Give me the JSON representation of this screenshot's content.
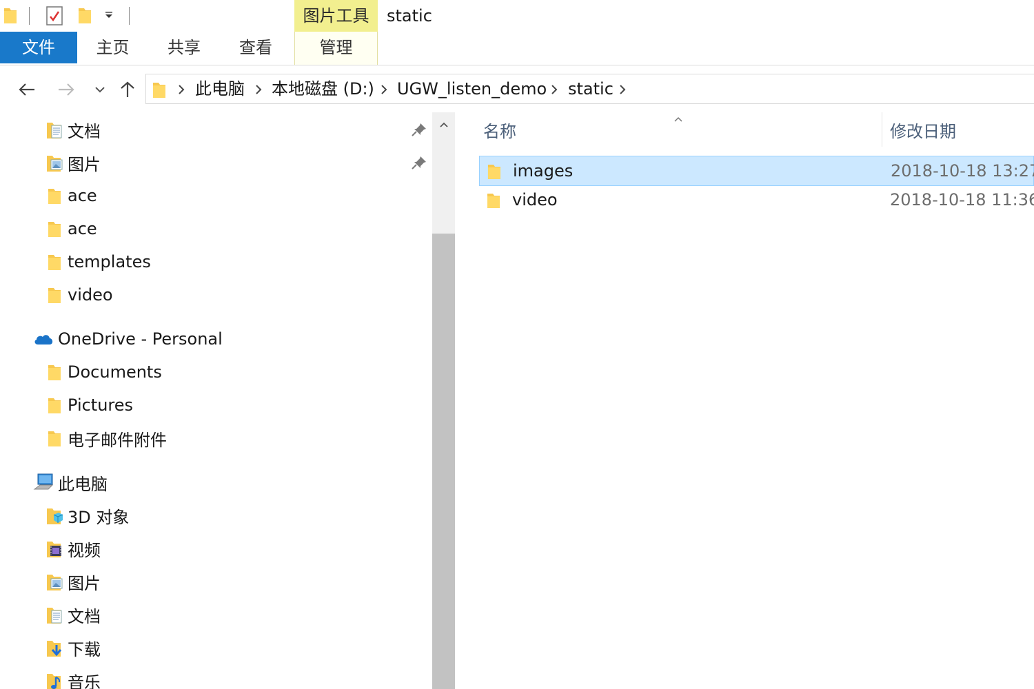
{
  "window": {
    "title": "static",
    "context_tab_label": "图片工具"
  },
  "quick_access_toolbar": {
    "items": [
      "folder-icon",
      "properties-icon",
      "new-folder-icon",
      "customize-dropdown-icon"
    ]
  },
  "ribbon": {
    "tabs": [
      {
        "label": "文件",
        "active": true
      },
      {
        "label": "主页"
      },
      {
        "label": "共享"
      },
      {
        "label": "查看"
      },
      {
        "label": "管理"
      }
    ],
    "accent_color": "#1979ca",
    "context_color": "#f2ef8f"
  },
  "address": {
    "crumbs": [
      "此电脑",
      "本地磁盘 (D:)",
      "UGW_listen_demo",
      "static"
    ]
  },
  "navigation": {
    "items": [
      {
        "label": "文档",
        "icon": "documents-folder-icon",
        "pinned": true
      },
      {
        "label": "图片",
        "icon": "pictures-folder-icon",
        "pinned": true
      },
      {
        "label": "ace",
        "icon": "folder-icon"
      },
      {
        "label": "ace",
        "icon": "folder-icon"
      },
      {
        "label": "templates",
        "icon": "folder-icon"
      },
      {
        "label": "video",
        "icon": "folder-icon"
      },
      {
        "label": "OneDrive - Personal",
        "icon": "onedrive-cloud-icon"
      },
      {
        "label": "Documents",
        "icon": "folder-icon"
      },
      {
        "label": "Pictures",
        "icon": "folder-icon"
      },
      {
        "label": "电子邮件附件",
        "icon": "folder-icon"
      },
      {
        "label": "此电脑",
        "icon": "this-pc-icon"
      },
      {
        "label": "3D 对象",
        "icon": "3d-objects-folder-icon"
      },
      {
        "label": "视频",
        "icon": "videos-folder-icon"
      },
      {
        "label": "图片",
        "icon": "pictures-folder-icon"
      },
      {
        "label": "文档",
        "icon": "documents-folder-icon"
      },
      {
        "label": "下载",
        "icon": "downloads-folder-icon"
      },
      {
        "label": "音乐",
        "icon": "music-folder-icon"
      }
    ]
  },
  "content": {
    "columns": {
      "name": "名称",
      "modified": "修改日期"
    },
    "rows": [
      {
        "name": "images",
        "modified": "2018-10-18 13:27",
        "selected": true
      },
      {
        "name": "video",
        "modified": "2018-10-18 11:36",
        "selected": false
      }
    ],
    "selection_color": "#cce8ff"
  }
}
